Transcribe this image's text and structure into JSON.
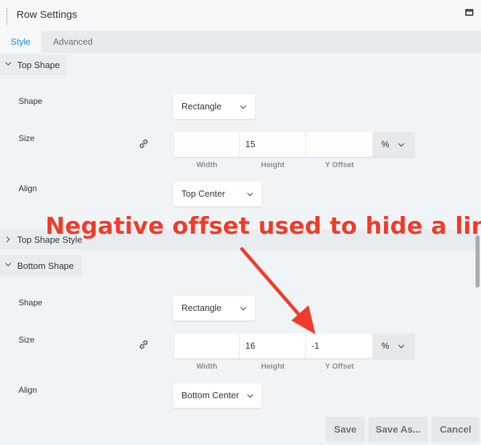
{
  "header": {
    "title": "Row Settings"
  },
  "tabs": [
    {
      "label": "Style"
    },
    {
      "label": "Advanced"
    }
  ],
  "sections": {
    "top_shape": {
      "label": "Top Shape",
      "shape_label": "Shape",
      "shape_value": "Rectangle",
      "size_label": "Size",
      "width_value": "",
      "height_value": "15",
      "yoffset_value": "",
      "unit": "%",
      "width_caption": "Width",
      "height_caption": "Height",
      "yoffset_caption": "Y Offset",
      "align_label": "Align",
      "align_value": "Top Center"
    },
    "top_shape_style": {
      "label": "Top Shape Style"
    },
    "bottom_shape": {
      "label": "Bottom Shape",
      "shape_label": "Shape",
      "shape_value": "Rectangle",
      "size_label": "Size",
      "width_value": "",
      "height_value": "16",
      "yoffset_value": "-1",
      "unit": "%",
      "width_caption": "Width",
      "height_caption": "Height",
      "yoffset_caption": "Y Offset",
      "align_label": "Align",
      "align_value": "Bottom Center"
    }
  },
  "annotation": {
    "text": "Negative offset used to hide a line",
    "color": "#f23a2b"
  },
  "footer": {
    "save_label": "Save",
    "save_as_label": "Save As...",
    "cancel_label": "Cancel"
  },
  "colors": {
    "accent": "#1a8cd3",
    "panel_bg": "#f1f4f7",
    "button_bg": "#e6e9ec"
  },
  "icons": {
    "link": "link-icon",
    "window": "window-icon",
    "handle": "drag-handle-icon"
  }
}
